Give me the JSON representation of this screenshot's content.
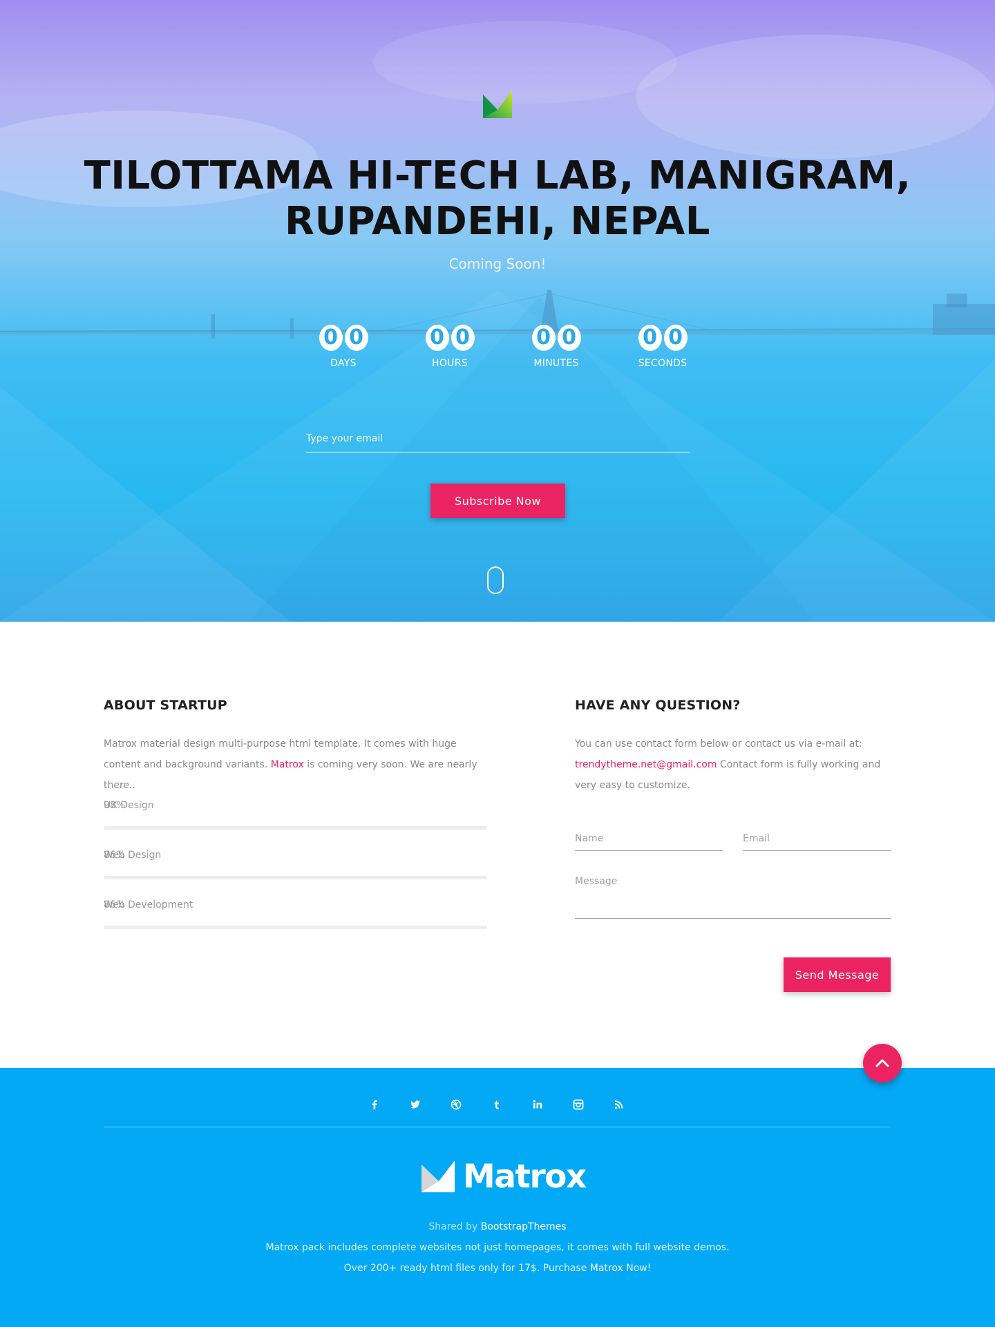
{
  "hero": {
    "title": "TILOTTAMA HI-TECH LAB, MANIGRAM, RUPANDEHI, NEPAL",
    "subtitle": "Coming Soon!",
    "countdown": [
      {
        "digits": [
          "0",
          "0"
        ],
        "label": "DAYS"
      },
      {
        "digits": [
          "0",
          "0"
        ],
        "label": "HOURS"
      },
      {
        "digits": [
          "0",
          "0"
        ],
        "label": "MINUTES"
      },
      {
        "digits": [
          "0",
          "0"
        ],
        "label": "SECONDS"
      }
    ],
    "email_placeholder": "Type your email",
    "subscribe_label": "Subscribe Now"
  },
  "about": {
    "title": "ABOUT STARTUP",
    "text_before": "Matrox material design multi-purpose html template. It comes with huge content and background variants. ",
    "text_link": "Matrox",
    "text_after": " is coming very soon. We are nearly there..",
    "skills": [
      {
        "name": "UX Design",
        "percent_text": "98%",
        "percent": 98
      },
      {
        "name": "Web Design",
        "percent_text": "86%",
        "percent": 86
      },
      {
        "name": "Web Development",
        "percent_text": "86%",
        "percent": 86
      }
    ]
  },
  "contact": {
    "title": "HAVE ANY QUESTION?",
    "text_before": "You can use contact form below or contact us via e-mail at: ",
    "email_link": "trendytheme.net@gmail.com",
    "text_after": " Contact form is fully working and very easy to customize.",
    "name_placeholder": "Name",
    "email_placeholder": "Email",
    "message_placeholder": "Message",
    "send_label": "Send Message"
  },
  "footer": {
    "social_icons": [
      "facebook-icon",
      "twitter-icon",
      "dribbble-icon",
      "tumblr-icon",
      "linkedin-icon",
      "instagram-icon",
      "rss-icon"
    ],
    "logo_text": "Matrox",
    "shared_by_prefix": "Shared by ",
    "shared_by_link": "BootstrapThemes",
    "line2": "Matrox pack includes complete websites not just homepages, it comes with full website demos.",
    "line3_before": "Over 200+ ready html files only for 17$. Purchase ",
    "line3_link": "Matrox",
    "line3_after": " Now!"
  },
  "colors": {
    "accent": "#ec2363",
    "footer_bg": "#03a9f4",
    "countdown_digit": "#29a8e8"
  }
}
